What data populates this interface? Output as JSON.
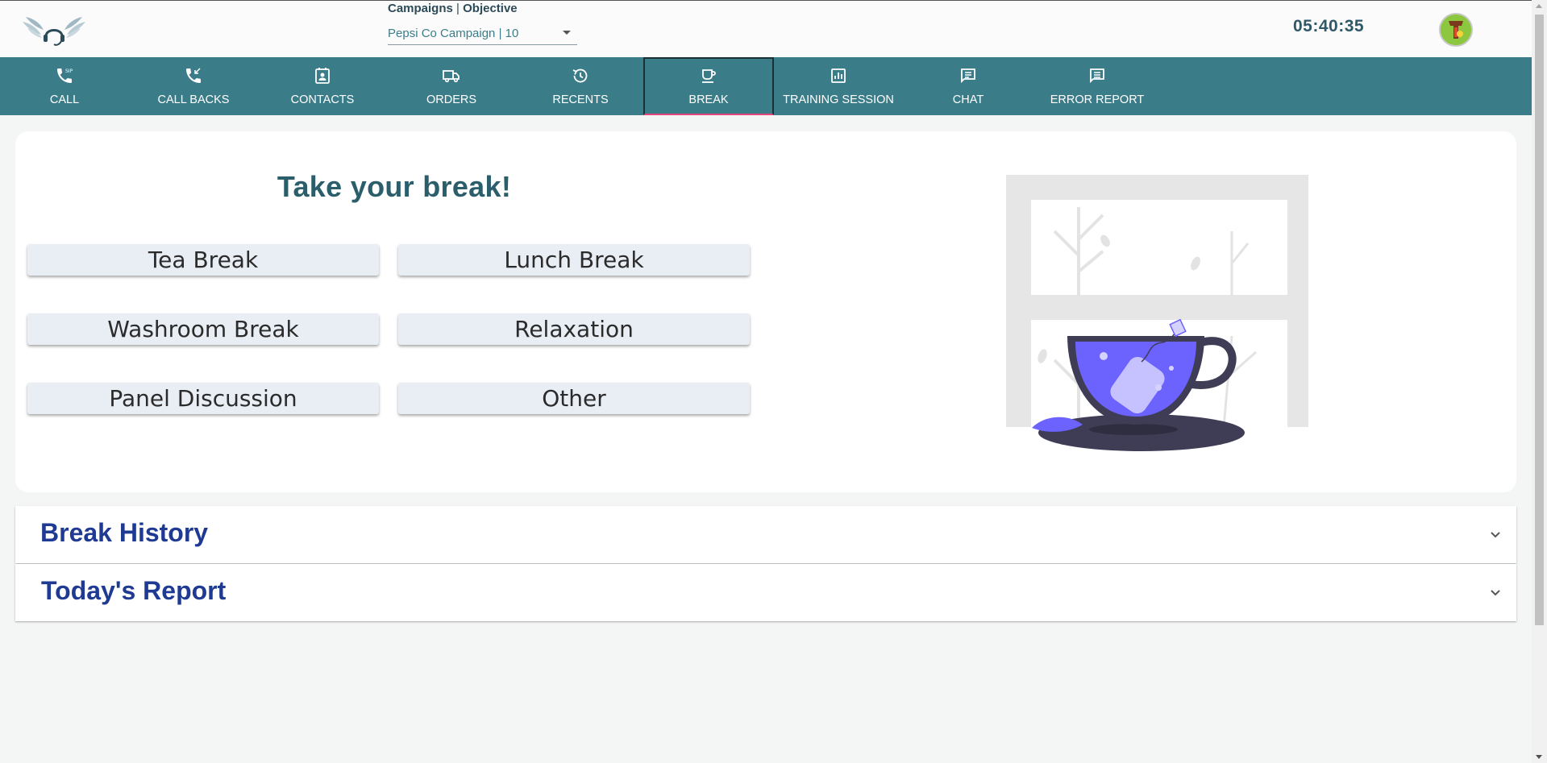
{
  "header": {
    "campaign_label": "Campaigns",
    "separator": "|",
    "objective_label": "Objective",
    "selected_campaign": "Pepsi Co Campaign | 10",
    "clock": "05:40:35"
  },
  "nav": {
    "items": [
      {
        "label": "CALL",
        "icon": "phone-sip-icon"
      },
      {
        "label": "CALL BACKS",
        "icon": "phone-callback-icon"
      },
      {
        "label": "CONTACTS",
        "icon": "contacts-icon"
      },
      {
        "label": "ORDERS",
        "icon": "truck-icon"
      },
      {
        "label": "RECENTS",
        "icon": "history-icon"
      },
      {
        "label": "BREAK",
        "icon": "coffee-icon",
        "active": true
      },
      {
        "label": "TRAINING SESSION",
        "icon": "chart-icon"
      },
      {
        "label": "CHAT",
        "icon": "chat-icon"
      },
      {
        "label": "ERROR REPORT",
        "icon": "feedback-icon"
      }
    ]
  },
  "break_card": {
    "title": "Take your break!",
    "buttons": [
      "Tea Break",
      "Lunch Break",
      "Washroom Break",
      "Relaxation",
      "Panel Discussion",
      "Other"
    ]
  },
  "accordions": {
    "history_title": "Break History",
    "report_title": "Today's Report"
  },
  "colors": {
    "nav_bg": "#3b7c89",
    "accent_underline": "#e4447a",
    "title_teal": "#2b5e6b",
    "accordion_title": "#1f3a93",
    "cup_purple": "#6c63ff"
  }
}
